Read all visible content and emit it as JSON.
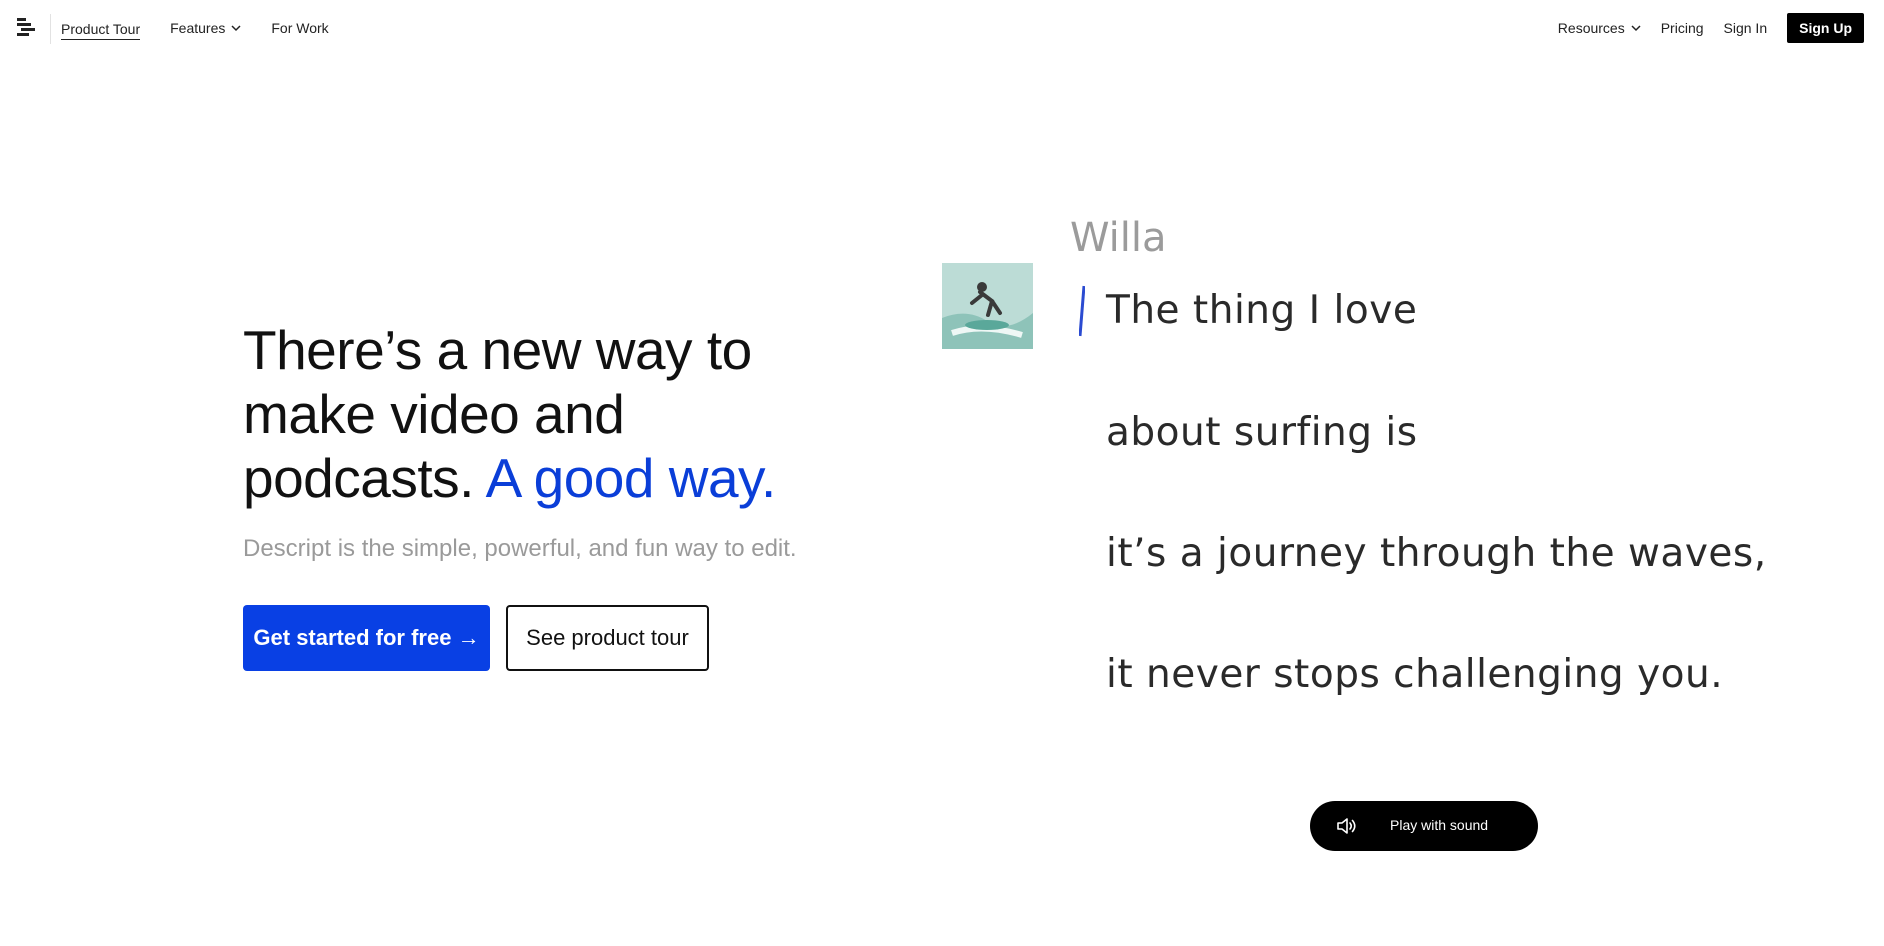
{
  "nav": {
    "left": [
      {
        "label": "Product Tour",
        "active": true
      },
      {
        "label": "Features",
        "dropdown": true
      },
      {
        "label": "For Work"
      }
    ],
    "right": [
      {
        "label": "Resources",
        "dropdown": true
      },
      {
        "label": "Pricing"
      },
      {
        "label": "Sign In"
      }
    ],
    "signup_label": "Sign Up"
  },
  "hero": {
    "title_line1": "There’s a new way to",
    "title_line2": "make video and",
    "title_line3": "podcasts.",
    "title_accent": "A good way.",
    "subtitle": "Descript is the simple, powerful, and fun way to edit.",
    "primary_cta": "Get started for free →",
    "secondary_cta": "See product tour"
  },
  "transcript": {
    "speaker": "Willa",
    "lines": [
      "The thing I love",
      "about surfing is",
      "it’s a journey through the waves,",
      "it never stops challenging you."
    ]
  },
  "play": {
    "label": "Play with sound",
    "icon": "speaker-icon"
  },
  "colors": {
    "accent": "#0a3ed8",
    "button_primary": "#0940e4",
    "black": "#000000"
  }
}
